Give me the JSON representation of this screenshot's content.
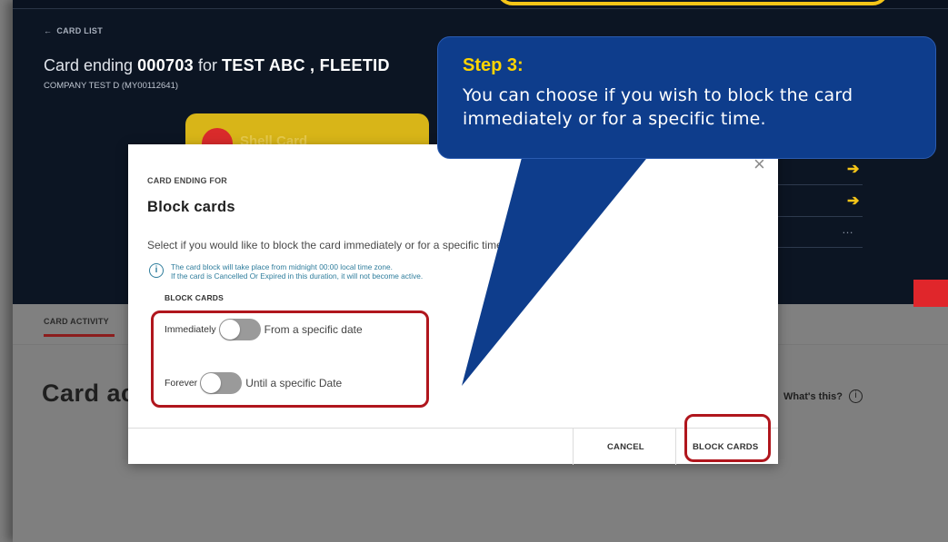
{
  "header": {
    "back_link": "CARD LIST",
    "card_title_prefix": "Card ending",
    "card_number": "000703",
    "card_title_for": "for",
    "card_holder": "TEST ABC , FLEETID",
    "company": "COMPANY TEST D (MY00112641)",
    "shell_card_label": "Shell Card"
  },
  "tabs": {
    "card_activity": "CARD ACTIVITY"
  },
  "page": {
    "section_heading": "Card ac",
    "whats_this": "What's this?"
  },
  "modal": {
    "kicker": "CARD ENDING FOR",
    "title": "Block cards",
    "description": "Select if you would like to block the card immediately or for a specific time.",
    "info_line1": "The card block will take place from midnight 00:00 local time zone.",
    "info_line2": "If the card is Cancelled Or Expired in this duration, it will not become active.",
    "section_label": "BLOCK CARDS",
    "toggle1_left": "Immediately",
    "toggle1_right": "From a specific date",
    "toggle2_left": "Forever",
    "toggle2_right": "Until a specific Date",
    "cancel": "CANCEL",
    "block": "BLOCK CARDS",
    "close": "×"
  },
  "callout": {
    "step": "Step 3:",
    "text": "You can choose if you wish to block the card immediately or for a specific time."
  },
  "colors": {
    "header_bg": "#0c1523",
    "callout_bg": "#0e3d8c",
    "callout_step": "#ffd400",
    "highlight": "#b0161d",
    "accent_yellow": "#f5c518",
    "accent_red": "#e0262b"
  }
}
